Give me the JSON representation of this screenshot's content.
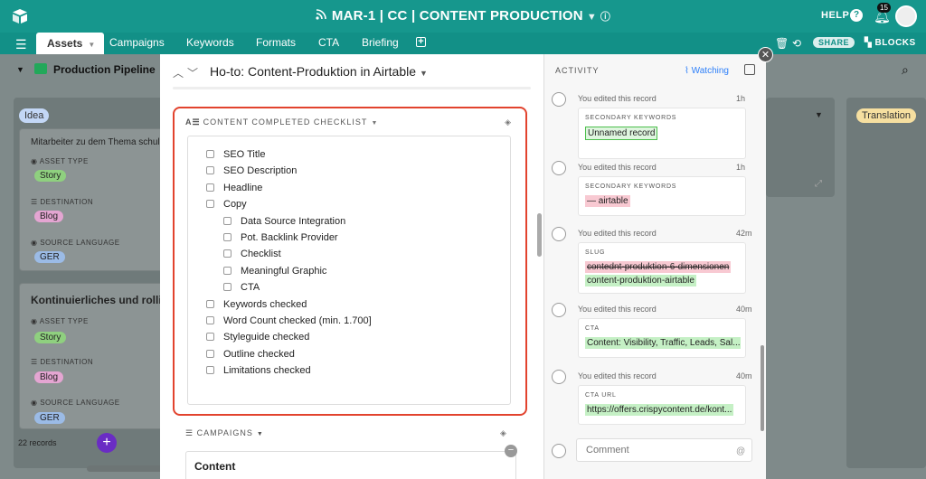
{
  "topbar": {
    "title": "MAR-1 | CC | CONTENT PRODUCTION",
    "help": "HELP",
    "notifications": "15"
  },
  "tabs": [
    {
      "label": "Assets",
      "active": true
    },
    {
      "label": "Campaigns"
    },
    {
      "label": "Keywords"
    },
    {
      "label": "Formats"
    },
    {
      "label": "CTA"
    },
    {
      "label": "Briefing"
    }
  ],
  "toolbar": {
    "share": "SHARE",
    "blocks": "BLOCKS"
  },
  "view": {
    "name": "Production Pipeline"
  },
  "board": {
    "columns": [
      {
        "label": "Idea",
        "color": "#c3d7f6"
      },
      {
        "label": "Translation",
        "color": "#f6dfa0"
      }
    ],
    "cards": [
      {
        "title": "Mitarbeiter zu dem Thema schulen",
        "asset_type_label": "ASSET TYPE",
        "asset_type": "Story",
        "destination_label": "DESTINATION",
        "destination": "Blog",
        "source_language_label": "SOURCE LANGUAGE",
        "source_language": "GER"
      },
      {
        "title": "Kontinuierliches und rollierendes",
        "asset_type_label": "ASSET TYPE",
        "asset_type": "Story",
        "destination_label": "DESTINATION",
        "destination": "Blog",
        "source_language_label": "SOURCE LANGUAGE",
        "source_language": "GER"
      }
    ],
    "records": "22 records"
  },
  "record": {
    "title": "Ho-to: Content-Produktion in Airtable",
    "checklist": {
      "label": "CONTENT COMPLETED CHECKLIST",
      "items": [
        {
          "label": "SEO Title",
          "indent": 0
        },
        {
          "label": "SEO Description",
          "indent": 0
        },
        {
          "label": "Headline",
          "indent": 0
        },
        {
          "label": "Copy",
          "indent": 0
        },
        {
          "label": "Data Source Integration",
          "indent": 1
        },
        {
          "label": "Pot. Backlink Provider",
          "indent": 1
        },
        {
          "label": "Checklist",
          "indent": 1
        },
        {
          "label": "Meaningful Graphic",
          "indent": 1
        },
        {
          "label": "CTA",
          "indent": 1
        },
        {
          "label": "Keywords checked",
          "indent": 0
        },
        {
          "label": "Word Count checked (min. 1.700]",
          "indent": 0
        },
        {
          "label": "Styleguide checked",
          "indent": 0
        },
        {
          "label": "Outline checked",
          "indent": 0
        },
        {
          "label": "Limitations checked",
          "indent": 0
        }
      ]
    },
    "campaigns": {
      "label": "CAMPAIGNS",
      "value": "Content"
    }
  },
  "activity": {
    "label": "ACTIVITY",
    "watching": "Watching",
    "entries": [
      {
        "text": "You edited this record",
        "time": "1h",
        "field": "SECONDARY KEYWORDS",
        "values": [
          {
            "text": "Unnamed record",
            "style": "box"
          }
        ]
      },
      {
        "text": "You edited this record",
        "time": "1h",
        "field": "SECONDARY KEYWORDS",
        "values": [
          {
            "text": "— airtable",
            "style": "del-pink"
          }
        ]
      },
      {
        "text": "You edited this record",
        "time": "42m",
        "field": "SLUG",
        "values": [
          {
            "text": "contednt-produktion-6-dimensionen",
            "style": "del"
          },
          {
            "text": "content-produktion-airtable",
            "style": "add"
          }
        ]
      },
      {
        "text": "You edited this record",
        "time": "40m",
        "field": "CTA",
        "values": [
          {
            "text": "Content: Visibility, Traffic, Leads, Sal...",
            "style": "add"
          }
        ]
      },
      {
        "text": "You edited this record",
        "time": "40m",
        "field": "CTA URL",
        "values": [
          {
            "text": "https://offers.crispycontent.de/kont...",
            "style": "add"
          }
        ]
      }
    ],
    "comment_placeholder": "Comment"
  }
}
